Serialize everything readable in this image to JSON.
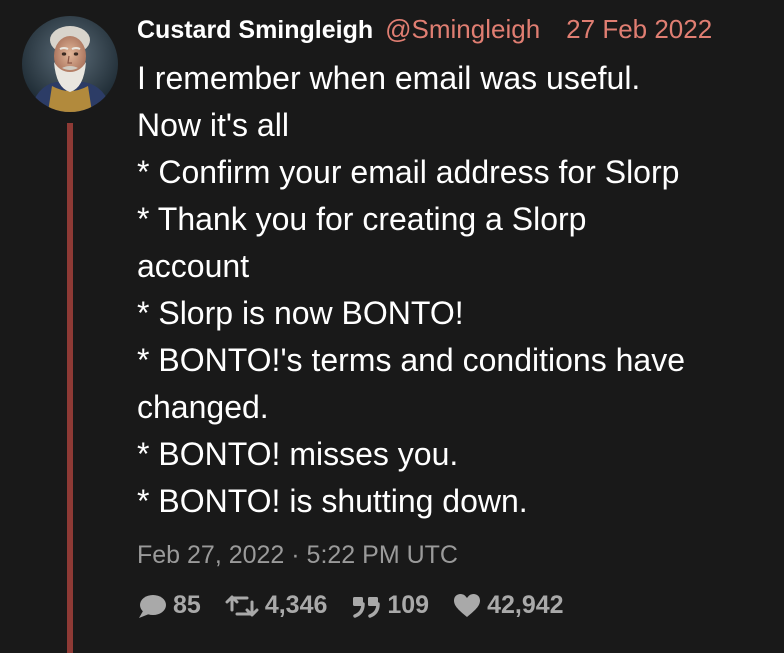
{
  "author": {
    "display_name": "Custard Smingleigh",
    "handle": "@Smingleigh",
    "date": "27 Feb 2022"
  },
  "tweet": {
    "lines": [
      "I remember when email was useful.",
      "Now it's all",
      "* Confirm your email address for Slorp",
      "* Thank you for creating a Slorp",
      "account",
      "* Slorp is now BONTO!",
      "* BONTO!'s terms and conditions have",
      "changed.",
      "* BONTO! misses you.",
      "* BONTO! is shutting down."
    ],
    "timestamp": "Feb 27, 2022 · 5:22 PM UTC"
  },
  "stats": {
    "replies": "85",
    "retweets": "4,346",
    "quotes": "109",
    "likes": "42,942"
  },
  "icons": {
    "replies": "comment-icon",
    "retweets": "retweet-icon",
    "quotes": "quote-icon",
    "likes": "heart-icon"
  },
  "colors": {
    "background": "#191919",
    "accent": "#e07e72",
    "thread_line": "#8e3a35",
    "muted": "#9a9a9a"
  }
}
